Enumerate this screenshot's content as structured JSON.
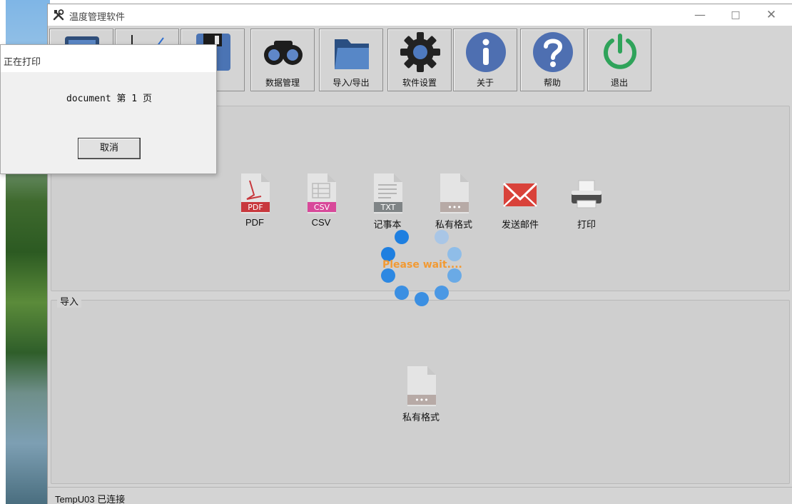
{
  "window": {
    "title": "温度管理软件",
    "controls": {
      "minimize": "—",
      "maximize": "□",
      "close": "✕"
    }
  },
  "toolbar": {
    "buttons": [
      {
        "label": "",
        "icon": "monitor-icon"
      },
      {
        "label": "",
        "icon": "chart-icon"
      },
      {
        "label": "置",
        "icon": "floppy-disk-icon"
      },
      {
        "label": "数据管理",
        "icon": "binoculars-icon"
      },
      {
        "label": "导入/导出",
        "icon": "folder-icon"
      },
      {
        "label": "软件设置",
        "icon": "gear-icon"
      },
      {
        "label": "关于",
        "icon": "info-icon"
      },
      {
        "label": "帮助",
        "icon": "help-icon"
      },
      {
        "label": "退出",
        "icon": "power-icon"
      }
    ]
  },
  "export_group": {
    "items": [
      {
        "label": "PDF",
        "badge": "PDF",
        "badge_color": "#c8383d"
      },
      {
        "label": "CSV",
        "badge": "CSV",
        "badge_color": "#d8499a"
      },
      {
        "label": "记事本",
        "badge": "TXT",
        "badge_color": "#7f8486"
      },
      {
        "label": "私有格式",
        "badge": "•••",
        "badge_color": "#b7aaa6"
      },
      {
        "label": "发送邮件",
        "badge": "",
        "badge_color": "#d9423a"
      },
      {
        "label": "打印",
        "badge": "",
        "badge_color": "#555555"
      }
    ]
  },
  "import_group": {
    "title": "导入",
    "items": [
      {
        "label": "私有格式",
        "badge": "•••",
        "badge_color": "#b7aaa6"
      }
    ]
  },
  "status": {
    "text": "TempU03 已连接"
  },
  "print_dialog": {
    "title": "正在打印",
    "document_line": "document 第 1 页",
    "cancel_label": "取消"
  },
  "spinner": {
    "text": "Please wait...."
  }
}
